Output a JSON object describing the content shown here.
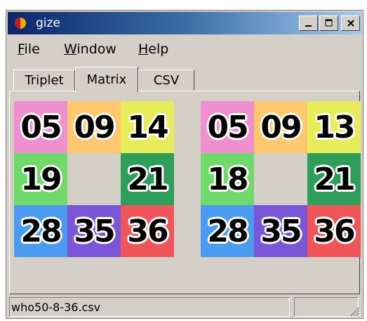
{
  "window": {
    "title": "gize"
  },
  "menu": [
    {
      "mnemonic": "F",
      "rest": "ile"
    },
    {
      "mnemonic": "W",
      "rest": "indow"
    },
    {
      "mnemonic": "H",
      "rest": "elp"
    }
  ],
  "tabs": [
    "Triplet",
    "Matrix",
    "CSV"
  ],
  "active_tab": "Matrix",
  "matrices": [
    {
      "cells": [
        {
          "value": "05",
          "color": "#f08fd0"
        },
        {
          "value": "09",
          "color": "#ffc86e"
        },
        {
          "value": "14",
          "color": "#e8ec5a"
        },
        {
          "value": "19",
          "color": "#6fd96a"
        },
        {
          "value": "",
          "color": "#d4d0c8"
        },
        {
          "value": "21",
          "color": "#2f9e5a"
        },
        {
          "value": "28",
          "color": "#4b9bf0"
        },
        {
          "value": "35",
          "color": "#7a55d8"
        },
        {
          "value": "36",
          "color": "#f0555a"
        }
      ]
    },
    {
      "cells": [
        {
          "value": "05",
          "color": "#f08fd0"
        },
        {
          "value": "09",
          "color": "#ffc86e"
        },
        {
          "value": "13",
          "color": "#e8ec5a"
        },
        {
          "value": "18",
          "color": "#6fd96a"
        },
        {
          "value": "",
          "color": "#d4d0c8"
        },
        {
          "value": "21",
          "color": "#2f9e5a"
        },
        {
          "value": "28",
          "color": "#4b9bf0"
        },
        {
          "value": "35",
          "color": "#7a55d8"
        },
        {
          "value": "36",
          "color": "#f0555a"
        }
      ]
    }
  ],
  "status": {
    "filename": "who50-8-36.csv",
    "second": ""
  }
}
